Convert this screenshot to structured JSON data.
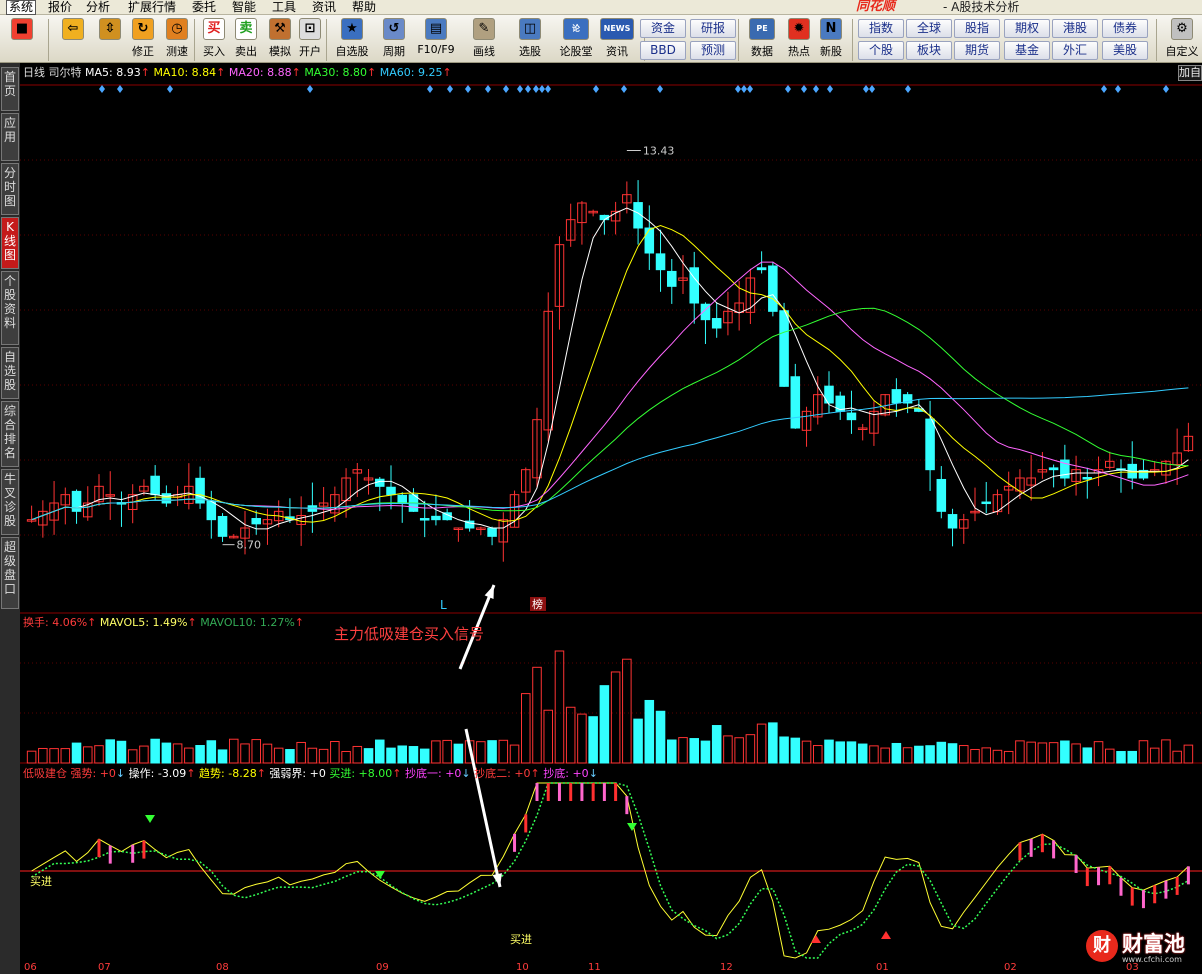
{
  "menubar": {
    "items": [
      "系统",
      "报价",
      "分析",
      "扩展行情",
      "委托",
      "智能",
      "工具",
      "资讯",
      "帮助"
    ],
    "brand": "同花顺",
    "subtitle": "- A股技术分析"
  },
  "toolbar": {
    "buttons": [
      {
        "label": "",
        "icon": "windows-icon"
      },
      {
        "label": "",
        "icon": "back-arrow-icon"
      },
      {
        "label": "",
        "icon": "up-down-arrows-icon"
      },
      {
        "label": "修正",
        "icon": "refresh-icon"
      },
      {
        "label": "测速",
        "icon": "clock-icon"
      },
      {
        "label": "买入",
        "icon": "buy-icon",
        "glyph": "买"
      },
      {
        "label": "卖出",
        "icon": "sell-icon",
        "glyph": "卖"
      },
      {
        "label": "模拟",
        "icon": "hammer-icon"
      },
      {
        "label": "开户",
        "icon": "lock-icon"
      },
      {
        "label": "自选股",
        "icon": "star-icon"
      },
      {
        "label": "周期",
        "icon": "cycle-icon"
      },
      {
        "label": "F10/F9",
        "icon": "f10-icon"
      },
      {
        "label": "画线",
        "icon": "pen-icon"
      },
      {
        "label": "选股",
        "icon": "select-stock-icon"
      },
      {
        "label": "论股堂",
        "icon": "forum-icon",
        "glyph": "论"
      },
      {
        "label": "资讯",
        "icon": "news-icon",
        "glyph": "NEWS"
      },
      {
        "label": "数据",
        "icon": "pe-icon",
        "glyph": "PE"
      },
      {
        "label": "热点",
        "icon": "hot-icon"
      },
      {
        "label": "新股",
        "icon": "new-stock-icon"
      },
      {
        "label": "自定义",
        "icon": "customize-icon"
      }
    ],
    "small_buttons": [
      "资金",
      "研报",
      "BBD",
      "预测",
      "指数",
      "全球",
      "股指",
      "期权",
      "港股",
      "债券",
      "个股",
      "板块",
      "期货",
      "基金",
      "外汇",
      "美股"
    ]
  },
  "sidebar": {
    "tabs": [
      "首页",
      "应用",
      "分时图",
      "K线图",
      "个股资料",
      "自选股",
      "综合排名",
      "牛叉诊股",
      "超级盘口"
    ],
    "active": "K线图"
  },
  "price_panel": {
    "period": "日线",
    "stock": "司尔特",
    "ma": [
      {
        "name": "MA5",
        "value": "8.93",
        "color": "#ffffff"
      },
      {
        "name": "MA10",
        "value": "8.84",
        "color": "#ffff00"
      },
      {
        "name": "MA20",
        "value": "8.88",
        "color": "#ff66ff"
      },
      {
        "name": "MA30",
        "value": "8.80",
        "color": "#33ff33"
      },
      {
        "name": "MA60",
        "value": "9.25",
        "color": "#33ccff"
      }
    ],
    "high_label": "13.43",
    "low_label": "8.70",
    "marker_l": "L",
    "marker_bang": "榜",
    "corner": "加自"
  },
  "volume_panel": {
    "items": [
      {
        "name": "换手",
        "value": "4.06%",
        "color": "#ff3c3c"
      },
      {
        "name": "MAVOL5",
        "value": "1.49%",
        "color": "#ffff66"
      },
      {
        "name": "MAVOL10",
        "value": "1.27%",
        "color": "#33aa55"
      }
    ]
  },
  "indicator_panel": {
    "items": [
      {
        "name": "低吸建仓",
        "value": "",
        "color": "#ff3c3c"
      },
      {
        "name": "强势",
        "value": "+0",
        "color": "#ff3c3c",
        "arrow": "down"
      },
      {
        "name": "操作",
        "value": "-3.09",
        "color": "#ffffff",
        "arrow": "up"
      },
      {
        "name": "趋势",
        "value": "-8.28",
        "color": "#ffff00",
        "arrow": "up"
      },
      {
        "name": "强弱界",
        "value": "+0",
        "color": "#ffffff"
      },
      {
        "name": "买进",
        "value": "+8.00",
        "color": "#33ff33",
        "arrow": "up"
      },
      {
        "name": "抄底一",
        "value": "+0",
        "color": "#ff44ff",
        "arrow": "down"
      },
      {
        "name": "抄底二",
        "value": "+0",
        "color": "#ff3c3c",
        "arrow": "up"
      },
      {
        "name": "抄底",
        "value": "+0",
        "color": "#ff44ff",
        "arrow": "down"
      }
    ],
    "buy_label": "买进"
  },
  "annotation": {
    "callout": "主力低吸建仓买入信号"
  },
  "xaxis": {
    "labels": [
      "06",
      "07",
      "08",
      "09",
      "10",
      "11",
      "12",
      "01",
      "02",
      "03"
    ]
  },
  "watermark": {
    "text": "财富池",
    "url": "www.cfchi.com"
  },
  "chart_data": {
    "type": "candlestick",
    "stock": "司尔特",
    "period": "日线",
    "months": [
      "06",
      "07",
      "08",
      "09",
      "10",
      "11",
      "12",
      "01",
      "02",
      "03"
    ],
    "ylim": [
      8.0,
      14.0
    ],
    "annotated_high": 13.43,
    "annotated_low": 8.7,
    "close_series": [
      9.0,
      9.1,
      9.2,
      9.3,
      9.1,
      9.2,
      9.4,
      9.3,
      9.2,
      9.3,
      9.4,
      9.3,
      9.2,
      9.3,
      9.4,
      9.2,
      9.0,
      8.8,
      8.8,
      8.9,
      8.95,
      9.0,
      9.1,
      9.0,
      9.05,
      9.1,
      9.2,
      9.3,
      9.5,
      9.6,
      9.5,
      9.4,
      9.3,
      9.2,
      9.1,
      9.0,
      9.0,
      9.0,
      8.9,
      8.9,
      8.9,
      8.8,
      9.0,
      9.3,
      9.6,
      10.2,
      11.5,
      12.3,
      12.6,
      12.8,
      12.7,
      12.6,
      12.7,
      12.9,
      12.5,
      12.2,
      12.0,
      11.8,
      11.9,
      11.6,
      11.4,
      11.3,
      11.5,
      11.6,
      11.9,
      12.0,
      11.5,
      10.6,
      10.1,
      10.3,
      10.5,
      10.4,
      10.3,
      10.2,
      10.1,
      10.3,
      10.5,
      10.4,
      10.4,
      10.3,
      9.6,
      9.1,
      8.9,
      9.0,
      9.1,
      9.2,
      9.3,
      9.4,
      9.5,
      9.5,
      9.6,
      9.6,
      9.5,
      9.6,
      9.5,
      9.6,
      9.7,
      9.6,
      9.5,
      9.5,
      9.6,
      9.7,
      9.8,
      10.0
    ],
    "ma60_color": "#33ccff"
  }
}
